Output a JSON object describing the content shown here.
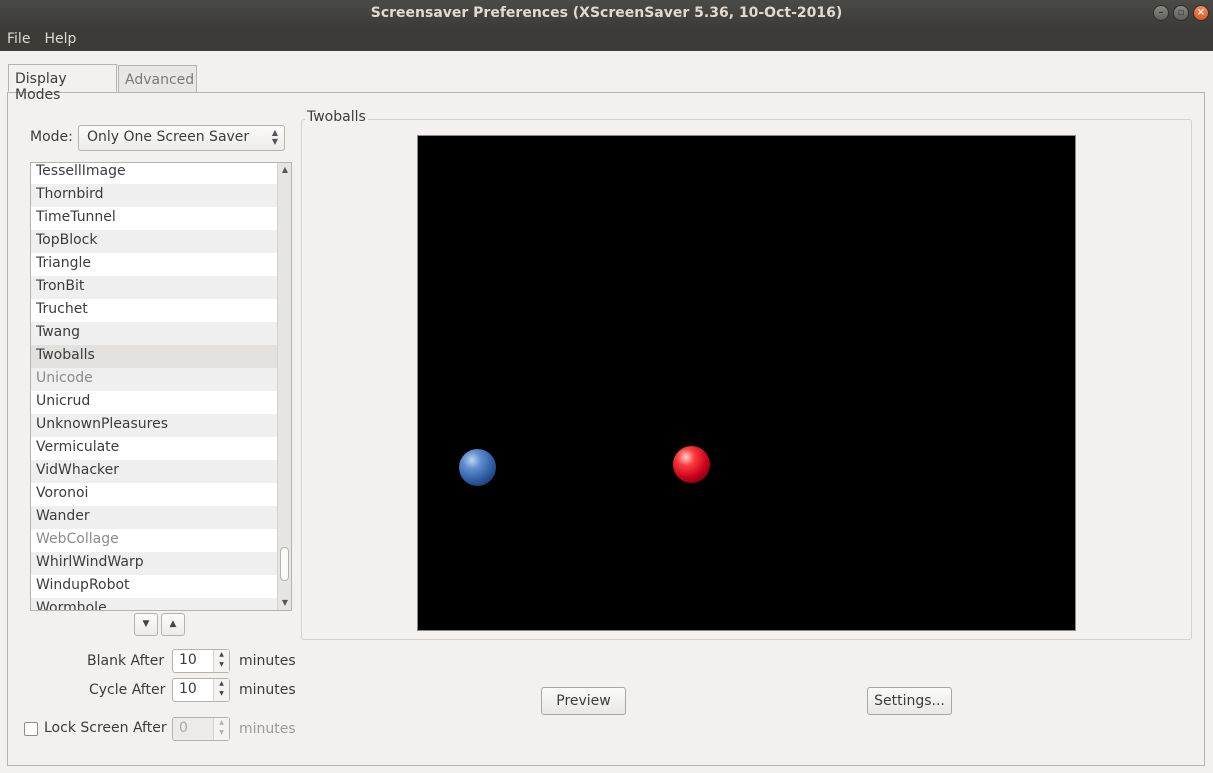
{
  "window": {
    "title": "Screensaver Preferences  (XScreenSaver 5.36, 10-Oct-2016)",
    "buttons": [
      "minimize",
      "maximize",
      "close"
    ]
  },
  "menu": {
    "file": "File",
    "help": "Help"
  },
  "tabs": {
    "display_modes": "Display Modes",
    "advanced": "Advanced"
  },
  "mode": {
    "label": "Mode:",
    "value": "Only One Screen Saver"
  },
  "saver_list": {
    "items": [
      {
        "name": "TessellImage",
        "disabled": false
      },
      {
        "name": "Thornbird",
        "disabled": false
      },
      {
        "name": "TimeTunnel",
        "disabled": false
      },
      {
        "name": "TopBlock",
        "disabled": false
      },
      {
        "name": "Triangle",
        "disabled": false
      },
      {
        "name": "TronBit",
        "disabled": false
      },
      {
        "name": "Truchet",
        "disabled": false
      },
      {
        "name": "Twang",
        "disabled": false
      },
      {
        "name": "Twoballs",
        "disabled": false,
        "selected": true
      },
      {
        "name": "Unicode",
        "disabled": true
      },
      {
        "name": "Unicrud",
        "disabled": false
      },
      {
        "name": "UnknownPleasures",
        "disabled": false
      },
      {
        "name": "Vermiculate",
        "disabled": false
      },
      {
        "name": "VidWhacker",
        "disabled": false
      },
      {
        "name": "Voronoi",
        "disabled": false
      },
      {
        "name": "Wander",
        "disabled": false
      },
      {
        "name": "WebCollage",
        "disabled": true
      },
      {
        "name": "WhirlWindWarp",
        "disabled": false
      },
      {
        "name": "WindupRobot",
        "disabled": false
      },
      {
        "name": "Wormhole",
        "disabled": false
      }
    ]
  },
  "preview_frame": {
    "label": "Twoballs"
  },
  "buttons": {
    "preview": "Preview",
    "settings": "Settings..."
  },
  "timing": {
    "blank_after": {
      "label": "Blank After",
      "value": "10",
      "unit": "minutes"
    },
    "cycle_after": {
      "label": "Cycle After",
      "value": "10",
      "unit": "minutes"
    },
    "lock_screen_after": {
      "label": "Lock Screen After",
      "value": "0",
      "unit": "minutes",
      "checked": false,
      "enabled": false
    }
  },
  "colors": {
    "preview_background": "#000000",
    "ball_blue": "#2d5aa0",
    "ball_red": "#c4001b"
  }
}
